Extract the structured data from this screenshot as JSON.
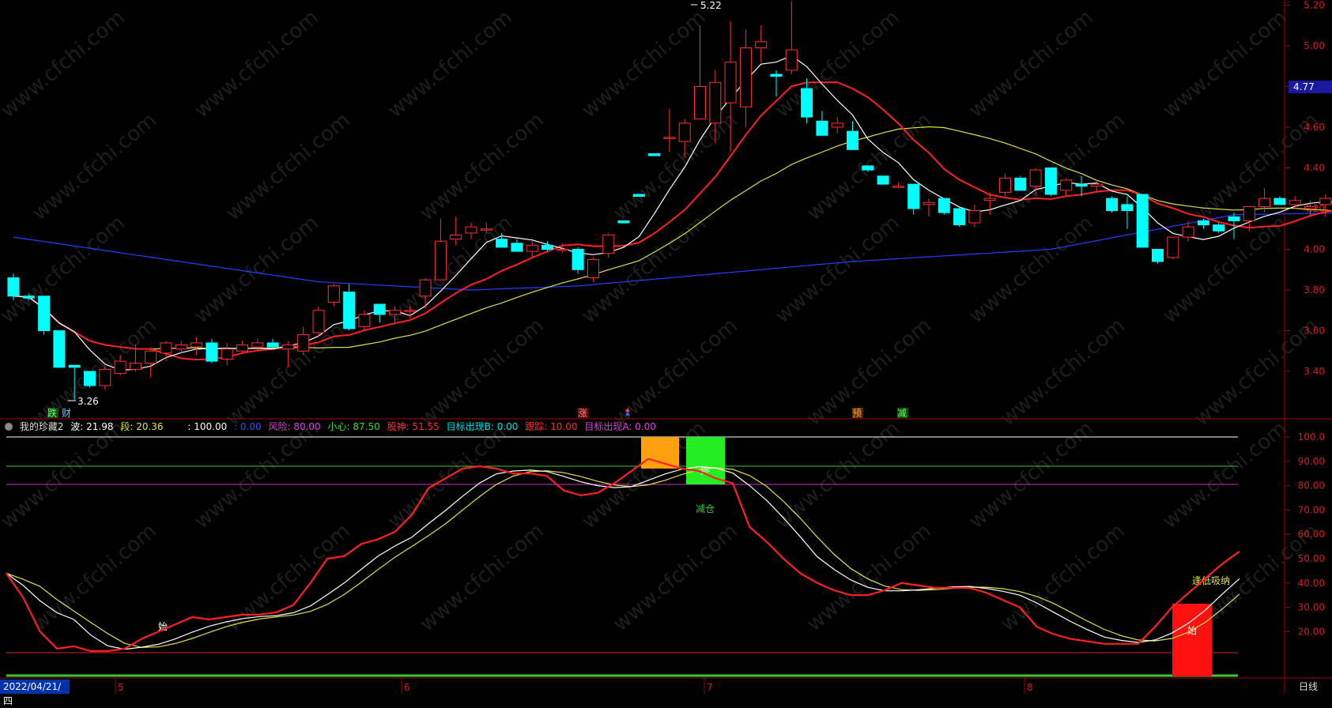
{
  "price_axis": {
    "ticks": [
      "5.20",
      "5.00",
      "4.80",
      "4.60",
      "4.40",
      "4.20",
      "4.00",
      "3.80",
      "3.60",
      "3.40"
    ],
    "current": "4.77"
  },
  "ind_axis": {
    "ticks": [
      "100.0",
      "90.00",
      "80.00",
      "70.00",
      "60.00",
      "50.00",
      "40.00",
      "30.00",
      "20.00"
    ]
  },
  "annotations": {
    "high": "5.22",
    "low": "3.26"
  },
  "signals": {
    "die": "跌",
    "cai": "财",
    "zhang": "涨",
    "yu": "预",
    "jian": "减"
  },
  "indicator": {
    "name": "我的珍藏2",
    "bo": "波: 21.98",
    "duan": "段: 20.36",
    "blank": ": 100.00",
    "zero": ": 0.00",
    "fengxian": "风险: 80.00",
    "xiaoxin": "小心: 87.50",
    "gushen": "股神: 51.55",
    "mubiaoB": "目标出现B: 0.00",
    "genzong": "跟踪: 10.00",
    "mubiaoA": "目标出现A: 0.00",
    "box_zhong": "终",
    "box_shi": "始",
    "label_jiancang": "减仓",
    "label_shi": "始",
    "label_fengdi": "逢低吸纳"
  },
  "time_axis": {
    "date": "2022/04/21/四",
    "months": [
      "5",
      "6",
      "7",
      "8"
    ],
    "period": "日线"
  },
  "watermark": "www.cfchi.com",
  "colors": {
    "up": "#ff3030",
    "down": "#00ffff",
    "ma5": "#ffffff",
    "ma10": "#ff2020",
    "ma20": "#e0e040",
    "ma60": "#2040ff"
  },
  "chart_data": {
    "type": "candlestick",
    "date_range": "2022/04/21 - 2022/08",
    "candles": [
      [
        3.86,
        3.88,
        3.75,
        3.77
      ],
      [
        3.77,
        3.78,
        3.75,
        3.76
      ],
      [
        3.77,
        3.77,
        3.58,
        3.6
      ],
      [
        3.6,
        3.6,
        3.42,
        3.42
      ],
      [
        3.43,
        3.43,
        3.26,
        3.42
      ],
      [
        3.4,
        3.4,
        3.32,
        3.33
      ],
      [
        3.33,
        3.43,
        3.31,
        3.41
      ],
      [
        3.39,
        3.48,
        3.38,
        3.45
      ],
      [
        3.41,
        3.53,
        3.4,
        3.44
      ],
      [
        3.44,
        3.52,
        3.37,
        3.5
      ],
      [
        3.49,
        3.55,
        3.45,
        3.54
      ],
      [
        3.51,
        3.55,
        3.49,
        3.53
      ],
      [
        3.52,
        3.57,
        3.48,
        3.54
      ],
      [
        3.54,
        3.56,
        3.44,
        3.45
      ],
      [
        3.46,
        3.54,
        3.43,
        3.51
      ],
      [
        3.5,
        3.55,
        3.49,
        3.53
      ],
      [
        3.52,
        3.56,
        3.5,
        3.54
      ],
      [
        3.54,
        3.56,
        3.51,
        3.52
      ],
      [
        3.51,
        3.55,
        3.42,
        3.53
      ],
      [
        3.5,
        3.62,
        3.48,
        3.58
      ],
      [
        3.59,
        3.72,
        3.57,
        3.7
      ],
      [
        3.74,
        3.83,
        3.72,
        3.82
      ],
      [
        3.79,
        3.83,
        3.6,
        3.61
      ],
      [
        3.62,
        3.7,
        3.6,
        3.68
      ],
      [
        3.73,
        3.73,
        3.64,
        3.68
      ],
      [
        3.68,
        3.72,
        3.64,
        3.7
      ],
      [
        3.7,
        3.72,
        3.66,
        3.7
      ],
      [
        3.77,
        3.86,
        3.71,
        3.85
      ],
      [
        3.85,
        4.15,
        3.85,
        4.04
      ],
      [
        4.05,
        4.16,
        4.02,
        4.07
      ],
      [
        4.08,
        4.13,
        4.05,
        4.11
      ],
      [
        4.1,
        4.13,
        4.08,
        4.1
      ],
      [
        4.05,
        4.08,
        4.01,
        4.01
      ],
      [
        4.03,
        4.05,
        3.99,
        3.99
      ],
      [
        3.99,
        4.04,
        3.96,
        4.02
      ],
      [
        4.02,
        4.04,
        3.99,
        4.0
      ],
      [
        4.0,
        4.03,
        3.98,
        4.0
      ],
      [
        4.0,
        4.01,
        3.88,
        3.9
      ],
      [
        3.86,
        3.96,
        3.84,
        3.95
      ],
      [
        3.98,
        4.08,
        3.96,
        4.07
      ],
      [
        4.14,
        4.14,
        4.13,
        4.13
      ],
      [
        4.27,
        4.27,
        4.26,
        4.26
      ],
      [
        4.47,
        4.47,
        4.46,
        4.46
      ],
      [
        4.55,
        4.69,
        4.48,
        4.55
      ],
      [
        4.53,
        4.64,
        4.45,
        4.62
      ],
      [
        4.64,
        5.1,
        4.64,
        4.8
      ],
      [
        4.62,
        4.88,
        4.52,
        4.82
      ],
      [
        4.72,
        5.12,
        4.48,
        4.92
      ],
      [
        4.7,
        5.08,
        4.6,
        4.99
      ],
      [
        4.99,
        5.1,
        4.92,
        5.02
      ],
      [
        4.86,
        4.88,
        4.75,
        4.85
      ],
      [
        4.88,
        5.22,
        4.86,
        4.98
      ],
      [
        4.79,
        4.84,
        4.62,
        4.65
      ],
      [
        4.63,
        4.68,
        4.56,
        4.56
      ],
      [
        4.6,
        4.65,
        4.57,
        4.62
      ],
      [
        4.58,
        4.63,
        4.49,
        4.49
      ],
      [
        4.41,
        4.41,
        4.38,
        4.39
      ],
      [
        4.36,
        4.36,
        4.32,
        4.32
      ],
      [
        4.31,
        4.33,
        4.3,
        4.31
      ],
      [
        4.32,
        4.32,
        4.17,
        4.2
      ],
      [
        4.22,
        4.25,
        4.16,
        4.23
      ],
      [
        4.25,
        4.25,
        4.17,
        4.18
      ],
      [
        4.2,
        4.21,
        4.11,
        4.12
      ],
      [
        4.13,
        4.22,
        4.11,
        4.19
      ],
      [
        4.24,
        4.28,
        4.17,
        4.25
      ],
      [
        4.28,
        4.37,
        4.26,
        4.35
      ],
      [
        4.35,
        4.36,
        4.29,
        4.29
      ],
      [
        4.31,
        4.4,
        4.27,
        4.39
      ],
      [
        4.4,
        4.4,
        4.26,
        4.27
      ],
      [
        4.29,
        4.35,
        4.26,
        4.34
      ],
      [
        4.32,
        4.36,
        4.26,
        4.31
      ],
      [
        4.31,
        4.34,
        4.28,
        4.32
      ],
      [
        4.25,
        4.26,
        4.18,
        4.19
      ],
      [
        4.22,
        4.26,
        4.1,
        4.19
      ],
      [
        4.27,
        4.27,
        4.01,
        4.01
      ],
      [
        4.0,
        4.0,
        3.93,
        3.94
      ],
      [
        3.96,
        4.06,
        3.95,
        4.06
      ],
      [
        4.06,
        4.14,
        4.04,
        4.11
      ],
      [
        4.14,
        4.15,
        4.1,
        4.12
      ],
      [
        4.12,
        4.13,
        4.08,
        4.09
      ],
      [
        4.16,
        4.18,
        4.05,
        4.14
      ],
      [
        4.14,
        4.21,
        4.09,
        4.21
      ],
      [
        4.21,
        4.3,
        4.18,
        4.25
      ],
      [
        4.25,
        4.26,
        4.22,
        4.22
      ],
      [
        4.22,
        4.26,
        4.2,
        4.24
      ],
      [
        4.2,
        4.24,
        4.16,
        4.21
      ],
      [
        4.22,
        4.27,
        4.16,
        4.25
      ],
      [
        4.26,
        4.27,
        4.21,
        4.21
      ],
      [
        4.2,
        4.28,
        4.18,
        4.21
      ]
    ]
  }
}
